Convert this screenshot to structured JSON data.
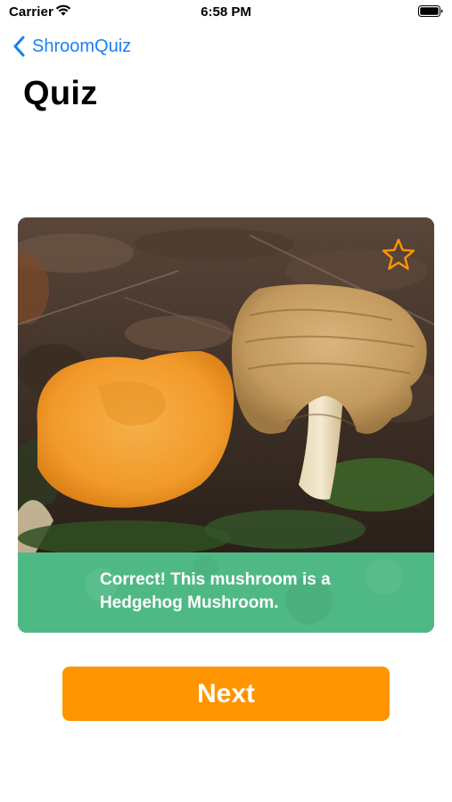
{
  "status_bar": {
    "carrier": "Carrier",
    "time": "6:58 PM"
  },
  "nav": {
    "back_label": "ShroomQuiz",
    "back_icon": "chevron-left-icon"
  },
  "page": {
    "title": "Quiz"
  },
  "quiz_card": {
    "favorite_icon": "star-outline-icon",
    "result_message": "Correct! This mushroom is a Hedgehog Mushroom.",
    "banner_color": "#4fb985"
  },
  "actions": {
    "next_label": "Next",
    "next_color": "#fe9500"
  },
  "colors": {
    "accent_blue": "#1a7ff6",
    "star_orange": "#fe9500"
  }
}
